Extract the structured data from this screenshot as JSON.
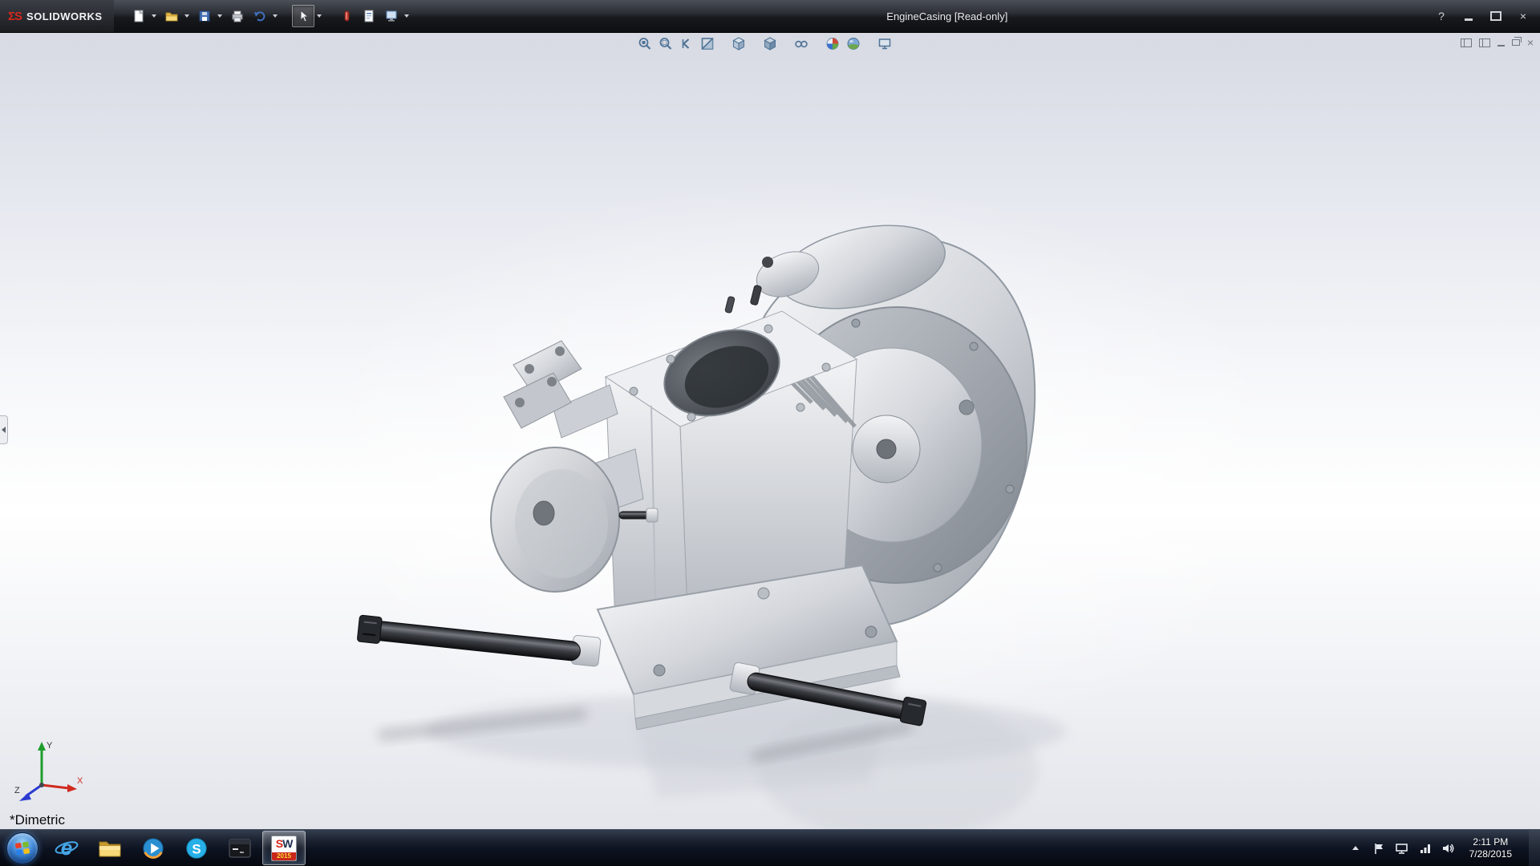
{
  "window": {
    "brand": "SOLIDWORKS",
    "logo_glyph": "ΣS",
    "title": "EngineCasing [Read-only]",
    "controls": {
      "help_glyph": "?",
      "close_glyph": "×"
    }
  },
  "toolbar": {
    "icons": [
      "new-document",
      "open",
      "save",
      "print",
      "undo",
      "select",
      "rebuild",
      "file-properties",
      "options"
    ]
  },
  "heads_up": {
    "icons": [
      "zoom-to-fit",
      "zoom-to-area",
      "previous-view",
      "section-view",
      "view-orientation",
      "display-style",
      "hide-show-items",
      "edit-appearance",
      "apply-scene",
      "view-settings"
    ]
  },
  "viewport": {
    "view_label": "*Dimetric",
    "axis_labels": {
      "x": "X",
      "y": "Y",
      "z": "Z"
    }
  },
  "taskbar": {
    "icons": [
      "start",
      "internet-explorer",
      "windows-explorer",
      "windows-media-player",
      "skype",
      "command-prompt",
      "solidworks"
    ],
    "ie_letter": "e",
    "skype_letter": "S",
    "sw_s": "S",
    "sw_w": "W",
    "sw_year": "2015",
    "tray": {
      "icons": [
        "hidden-icons",
        "action-center",
        "display",
        "network",
        "volume"
      ],
      "time": "2:11 PM",
      "date": "7/28/2015"
    }
  },
  "colors": {
    "accent_red": "#c8271b",
    "titlebar": "#1c1f24",
    "taskbar": "#0b0f17",
    "viewport_top": "#d9dce5",
    "metal_light": "#f5f6f8",
    "metal_dark": "#9aa0a8"
  }
}
